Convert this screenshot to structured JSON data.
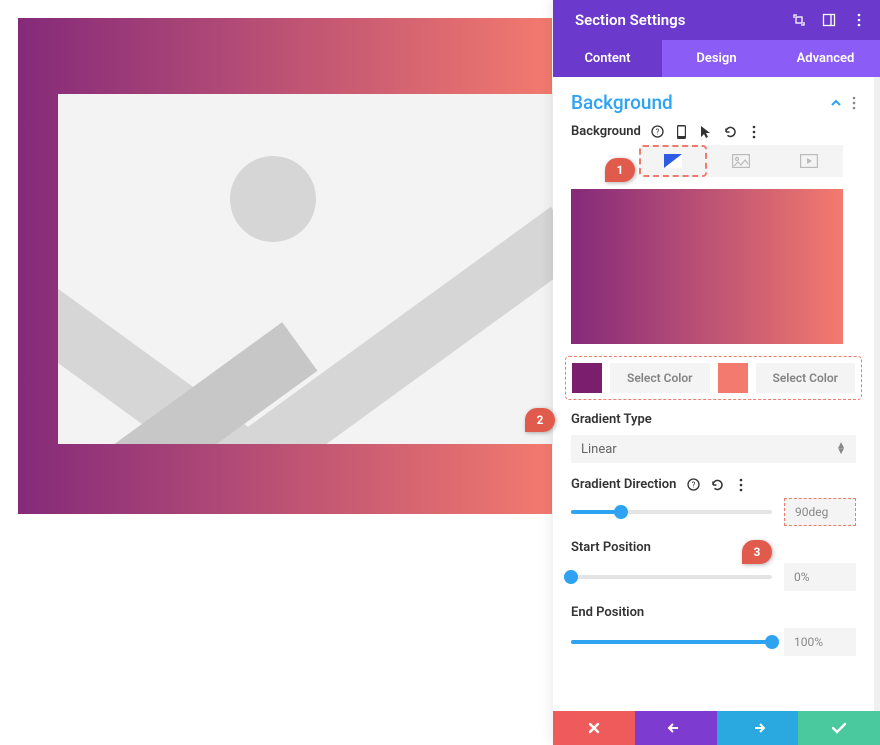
{
  "header": {
    "title": "Section Settings"
  },
  "tabs": [
    "Content",
    "Design",
    "Advanced"
  ],
  "section": {
    "title": "Background",
    "bg_label": "Background"
  },
  "colors": {
    "swatch1": "#7b1e6e",
    "swatch2": "#f37a6e",
    "select_label": "Select Color"
  },
  "gradient_type": {
    "label": "Gradient Type",
    "value": "Linear"
  },
  "gradient_direction": {
    "label": "Gradient Direction",
    "value": "90deg",
    "percent": 25
  },
  "start_position": {
    "label": "Start Position",
    "value": "0%",
    "percent": 0
  },
  "end_position": {
    "label": "End Position",
    "value": "100%",
    "percent": 100
  },
  "callouts": {
    "c1": "1",
    "c2": "2",
    "c3": "3"
  }
}
